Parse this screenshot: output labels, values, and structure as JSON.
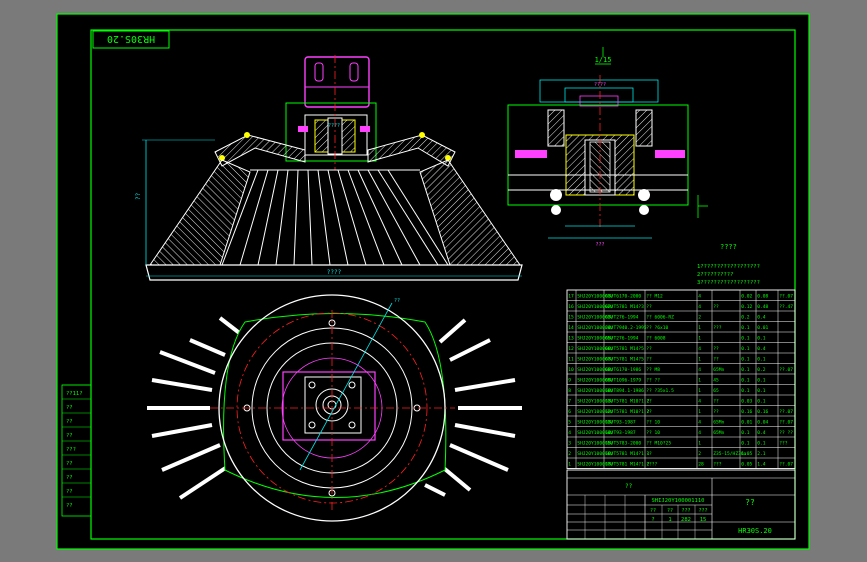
{
  "drawing": {
    "code_stamp": "HR30S.20",
    "title_block_code": "HR30S.20",
    "title_block_question": "??",
    "title_block_name": "??",
    "title_block_subtitle": "SHIJ20Y100001110",
    "section_mark": "1/15",
    "tech_heading": "????",
    "tech_notes": [
      "1??????????????????",
      "2??????????",
      "3??????????????????"
    ],
    "left_block_labels": [
      "??11?",
      "??",
      "??",
      "??",
      "???",
      "??",
      "??",
      "??",
      "??"
    ],
    "dims": {
      "top_width_label": "????",
      "bottom_width_label": "????",
      "height_label": "??",
      "circle_callout": "??",
      "side_dim_label": "????",
      "side_bottom_label": "???"
    },
    "title_row_labels": [
      "??",
      "??",
      "???",
      "???"
    ],
    "title_row_values": [
      "?",
      "1",
      "282",
      "15"
    ]
  },
  "bom": [
    [
      "17",
      "SHJ20Y100001U",
      "GB/T6170-2000",
      "?? M12",
      "4",
      "",
      "0.02",
      "0.08",
      "??.07"
    ],
    [
      "16",
      "SHJ20Y100002U",
      "GB/T5781 M14?3",
      "??",
      "4",
      "??",
      "0.12",
      "0.48",
      "??.47"
    ],
    [
      "15",
      "SHJ20Y100003U",
      "GB/T276-1994",
      "?? 6006-RZ",
      "2",
      "",
      "0.2",
      "0.4",
      ""
    ],
    [
      "14",
      "SHJ20Y100004U",
      "JB/T7940.2-1995",
      "?? ?6x10",
      "1",
      "???",
      "0.1",
      "0.01",
      ""
    ],
    [
      "13",
      "SHJ20Y100005U",
      "GB/T276-1994",
      "?? 6008",
      "1",
      "",
      "0.1",
      "0.1",
      ""
    ],
    [
      "12",
      "SHJ20Y100006U",
      "GB/T5781 M14?5",
      "??",
      "4",
      "??",
      "0.1",
      "0.4",
      ""
    ],
    [
      "11",
      "SHJ20Y100007U",
      "GB/T5781 M14?5",
      "??",
      "1",
      "??",
      "0.1",
      "0.1",
      ""
    ],
    [
      "10",
      "SHJ20Y100008U",
      "GB/T6170-1986",
      "?? M8",
      "4",
      "65Mn",
      "0.1",
      "0.2",
      "??.07"
    ],
    [
      "9",
      "SHJ20Y100009U",
      "GB/T1096-1979",
      "?? ??",
      "1",
      "45",
      "0.1",
      "0.1",
      ""
    ],
    [
      "8",
      "SHJ20Y100010U",
      "GB/T894.1-1986",
      "?? ?35x1.5",
      "1",
      "65",
      "0.1",
      "0.1",
      ""
    ],
    [
      "7",
      "SHJ20Y100011U",
      "GB/T5781 M10?1.2",
      "??",
      "4",
      "??",
      "0.03",
      "0.1",
      ""
    ],
    [
      "6",
      "SHJ20Y100012U",
      "GB/T5781 M10?1.2",
      "??",
      "1",
      "??",
      "0.16",
      "0.16",
      "??.07"
    ],
    [
      "5",
      "SHJ20Y100013U",
      "GB/T93-1987",
      "?? 10",
      "4",
      "65Mn",
      "0.01",
      "0.04",
      "??.07"
    ],
    [
      "4",
      "SHJ20Y100014U",
      "GB/T93-1987",
      "?? 10",
      "4",
      "65Mn",
      "0.1",
      "0.4",
      "?? ??"
    ],
    [
      "3",
      "SHJ20Y100015U",
      "GB/T5783-2000",
      "?? M10?25",
      "1",
      "",
      "0.1",
      "0.1",
      "???"
    ],
    [
      "2",
      "SHJ20Y100016U",
      "GB/T5781 M14?1.1",
      "??",
      "2",
      "Z35-15/HZ36a",
      "1.05",
      "2.1",
      ""
    ],
    [
      "1",
      "SHJ20Y100017U",
      "GB/T5781 M14?1.2",
      "????",
      "28",
      "???",
      "0.05",
      "1.4",
      "??.07"
    ]
  ],
  "colors": {
    "frame": "#00ff00",
    "background": "#000000",
    "outer": "#7a7a7a",
    "line_white": "#ffffff",
    "center_line": "#ff2020",
    "dimension": "#00e6e6",
    "part_magenta": "#ff40ff",
    "hatch": "#ffffff",
    "highlight": "#ffff00",
    "text_green": "#00ff00"
  },
  "icons": {
    "north_arrow": "section-arrow-icon"
  }
}
